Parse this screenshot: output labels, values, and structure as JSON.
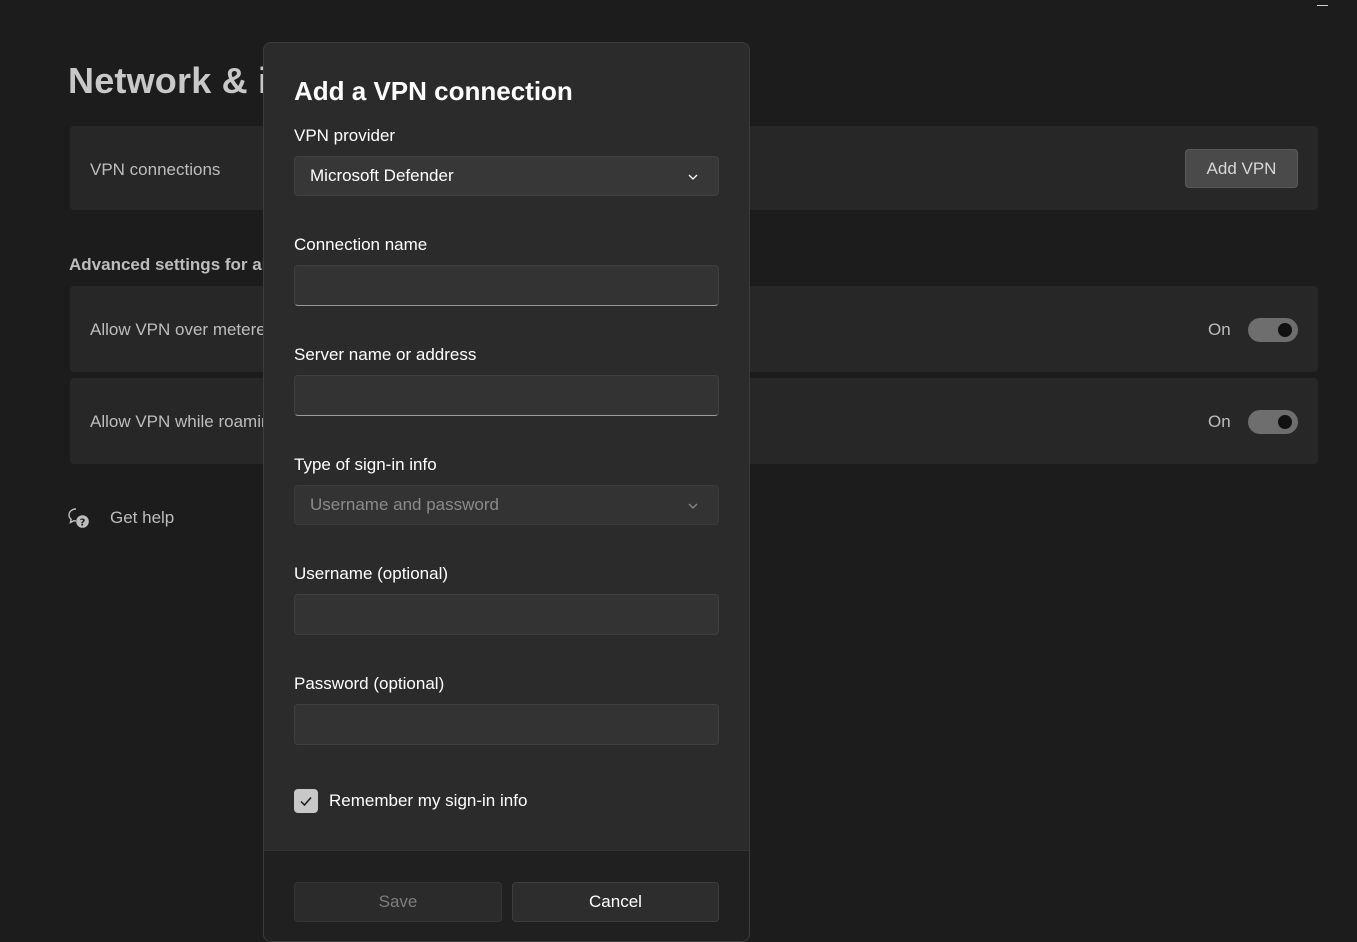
{
  "window": {
    "minimize_icon": "minimize-icon"
  },
  "background": {
    "page_title": "Network & internet > VPN",
    "vpn_connections_label": "VPN connections",
    "add_vpn_label": "Add VPN",
    "advanced_heading": "Advanced settings for all VPN connections",
    "settings": [
      {
        "label": "Allow VPN over metered networks",
        "state": "On"
      },
      {
        "label": "Allow VPN while roaming",
        "state": "On"
      }
    ],
    "get_help_label": "Get help",
    "get_help_icon": "help-chat-icon"
  },
  "dialog": {
    "title": "Add a VPN connection",
    "vpn_provider": {
      "label": "VPN provider",
      "value": "Microsoft Defender"
    },
    "connection_name": {
      "label": "Connection name",
      "value": ""
    },
    "server": {
      "label": "Server name or address",
      "value": ""
    },
    "signin_type": {
      "label": "Type of sign-in info",
      "value": "Username and password"
    },
    "username": {
      "label": "Username (optional)",
      "value": ""
    },
    "password": {
      "label": "Password (optional)",
      "value": ""
    },
    "remember": {
      "label": "Remember my sign-in info",
      "checked": true
    },
    "save_label": "Save",
    "cancel_label": "Cancel"
  }
}
